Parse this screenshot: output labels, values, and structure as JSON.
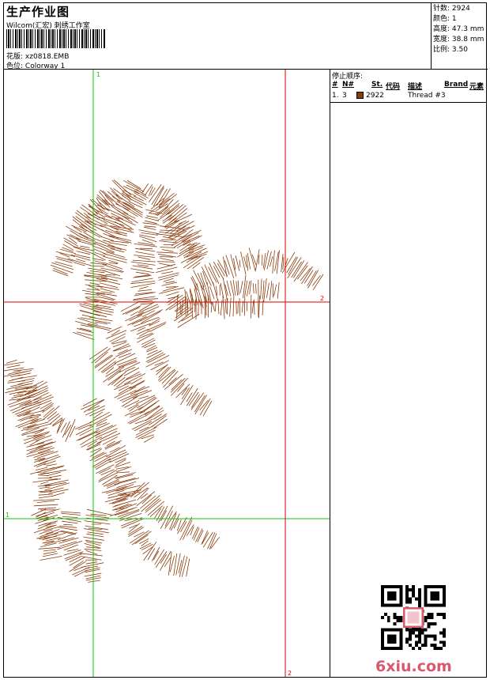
{
  "header": {
    "title": "生产作业图",
    "subtitle": "Wilcom(汇宏) 刺绣工作室",
    "design_label": "花版:",
    "design_value": "xz0818.EMB",
    "colorway_label": "色位:",
    "colorway_value": "Colorway 1"
  },
  "stats": [
    {
      "label": "针数:",
      "value": "2924"
    },
    {
      "label": "颜色:",
      "value": "1"
    },
    {
      "label": "高度:",
      "value": "47.3 mm"
    },
    {
      "label": "宽度:",
      "value": "38.8 mm"
    },
    {
      "label": "比例:",
      "value": "3.50"
    }
  ],
  "stop_sequence": {
    "title": "停止顺序:",
    "columns": [
      "#",
      "N#",
      "St.",
      "代码",
      "描述",
      "Brand",
      "元素"
    ],
    "rows": [
      {
        "num": "1.",
        "needle": "3",
        "code": "2922",
        "description": "Thread #3",
        "color": "#8b3a0a"
      }
    ]
  },
  "guides": {
    "vertical_green_label": "1",
    "horizontal_green_label": "1",
    "horizontal_red_label": "2",
    "vertical_red_label": "2",
    "green_color": "#00cc00",
    "red_color": "#e00000"
  },
  "design": {
    "thread_color": "#8b3a0a",
    "motif": "rearing-horse"
  },
  "watermark": {
    "text": "6xiu.com",
    "color": "#d9586a"
  }
}
